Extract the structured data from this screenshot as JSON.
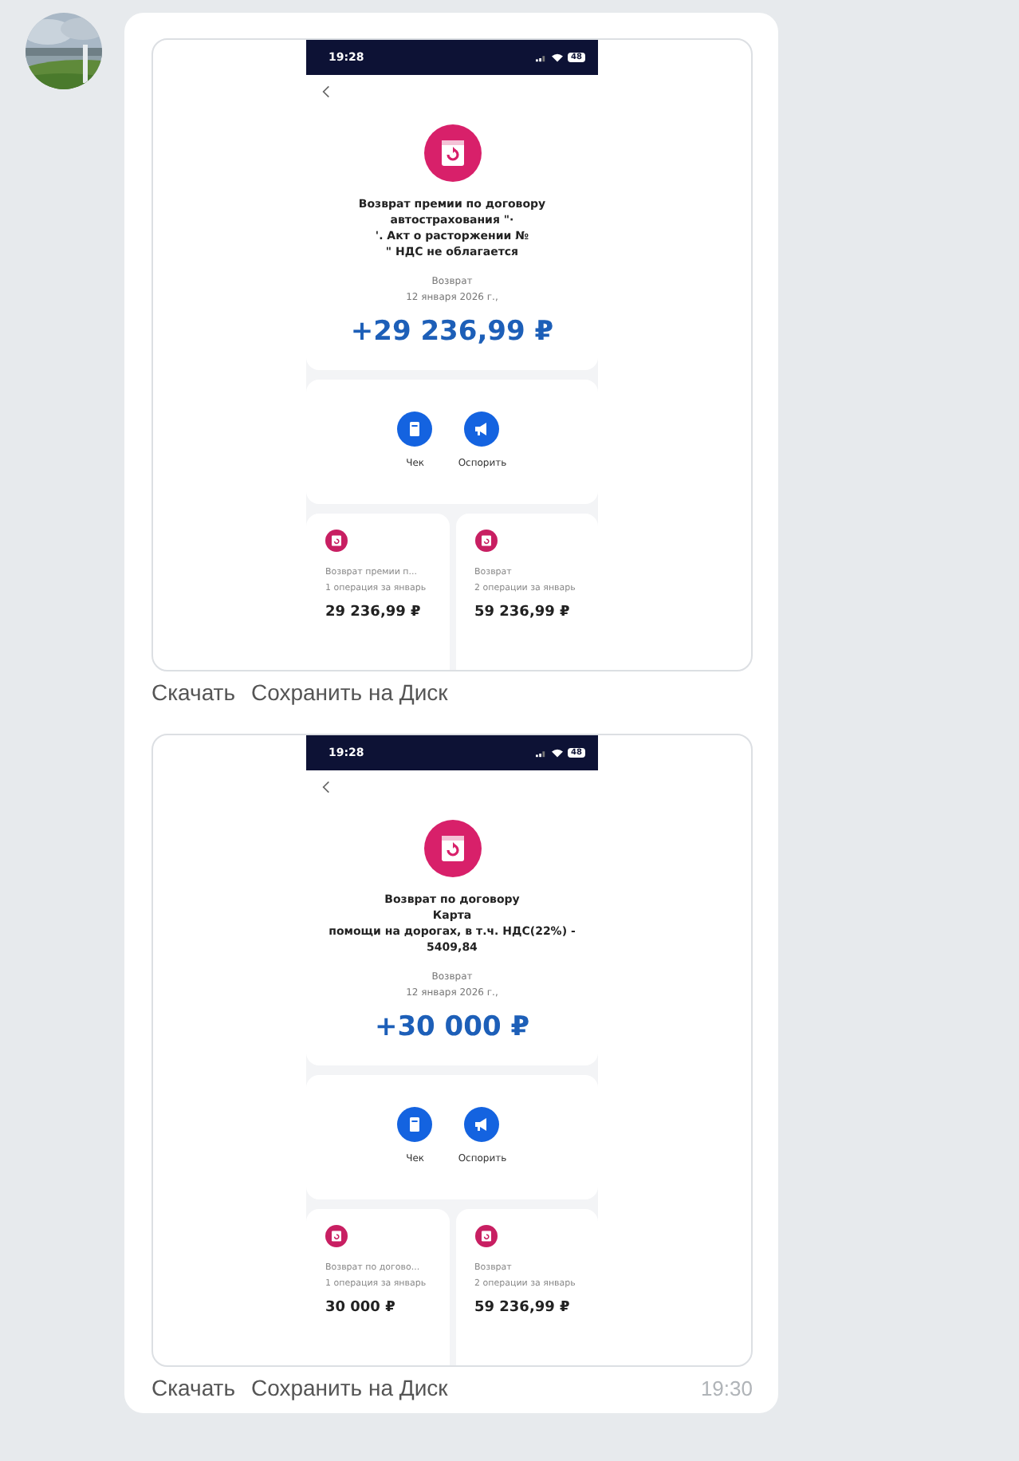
{
  "messages": [
    {
      "status_time": "19:28",
      "battery": "48",
      "title_lines": [
        "Возврат премии по договору",
        "автострахования \"·",
        "'. Акт о расторжении №",
        "\" НДС не облагается"
      ],
      "label": "Возврат",
      "date": "12 января 2026 г.,",
      "amount": "+29 236,99 ₽",
      "actions": [
        {
          "kind": "receipt",
          "label": "Чек"
        },
        {
          "kind": "dispute",
          "label": "Оспорить"
        }
      ],
      "tiles": [
        {
          "name": "Возврат премии п...",
          "ops": "1 операция за январь",
          "amount": "29 236,99 ₽"
        },
        {
          "name": "Возврат",
          "ops": "2 операции за январь",
          "amount": "59 236,99 ₽"
        }
      ],
      "links": [
        "Скачать",
        "Сохранить на Диск"
      ]
    },
    {
      "status_time": "19:28",
      "battery": "48",
      "title_lines": [
        "Возврат по договору",
        "Карта",
        "помощи на дорогах, в т.ч. НДС(22%) -",
        "5409,84"
      ],
      "label": "Возврат",
      "date": "12 января 2026 г.,",
      "amount": "+30 000 ₽",
      "actions": [
        {
          "kind": "receipt",
          "label": "Чек"
        },
        {
          "kind": "dispute",
          "label": "Оспорить"
        }
      ],
      "tiles": [
        {
          "name": "Возврат по догово...",
          "ops": "1 операция за январь",
          "amount": "30 000 ₽"
        },
        {
          "name": "Возврат",
          "ops": "2 операции за январь",
          "amount": "59 236,99 ₽"
        }
      ],
      "links": [
        "Скачать",
        "Сохранить на Диск"
      ],
      "time": "19:30"
    }
  ]
}
